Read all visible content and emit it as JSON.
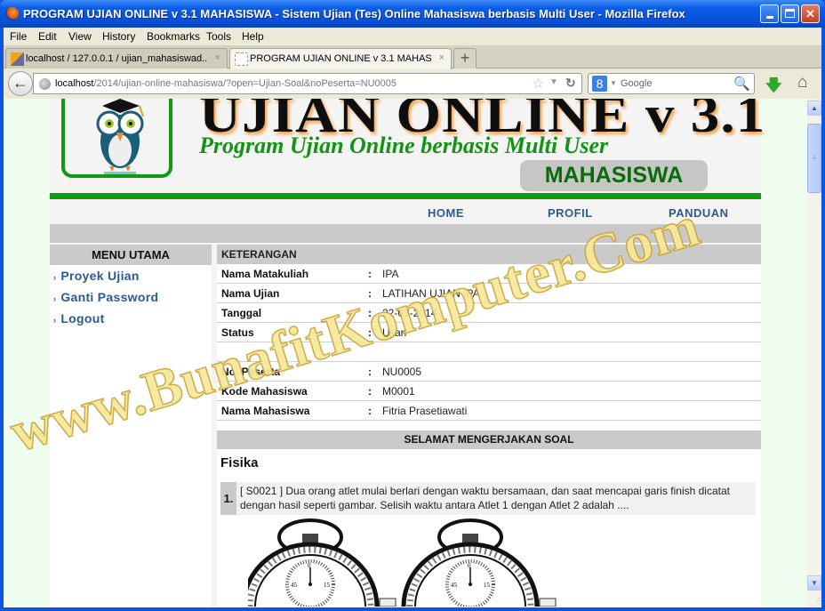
{
  "window": {
    "title": "PROGRAM UJIAN ONLINE v 3.1 MAHASISWA - Sistem Ujian (Tes) Online Mahasiswa berbasis Multi User - Mozilla Firefox",
    "minimize_label": "Minimize",
    "maximize_label": "Maximize",
    "close_label": "✕"
  },
  "menubar": {
    "items": [
      {
        "key": "F",
        "rest": "ile"
      },
      {
        "key": "E",
        "rest": "dit"
      },
      {
        "key": "V",
        "rest": "iew"
      },
      {
        "key": "s",
        "label": "History"
      },
      {
        "key": "B",
        "rest": "ookmarks"
      },
      {
        "key": "T",
        "rest": "ools"
      },
      {
        "key": "H",
        "rest": "elp"
      }
    ],
    "labels": [
      "File",
      "Edit",
      "View",
      "History",
      "Bookmarks",
      "Tools",
      "Help"
    ]
  },
  "tabs": [
    {
      "label": "localhost / 127.0.0.1 / ujian_mahasiswad...",
      "close": "×",
      "icon": "phpmyadmin-icon"
    },
    {
      "label": "PROGRAM UJIAN ONLINE v 3.1 MAHASI...",
      "close": "×",
      "icon": "blank-page-icon",
      "active": true
    }
  ],
  "newtab_label": "+",
  "navbar": {
    "url_host": "localhost",
    "url_path": "/2014/ujian-online-mahasiswa/?open=Ujian-Soal&noPeserta=NU0005",
    "search_placeholder": "Google",
    "search_engine": "8"
  },
  "header": {
    "title": "UJIAN ONLINE v 3.1",
    "subtitle": "Program Ujian Online berbasis Multi User",
    "badge": "MAHASISWA"
  },
  "nav": {
    "links": [
      "HOME",
      "PROFIL",
      "PANDUAN"
    ]
  },
  "sidebar": {
    "heading": "MENU UTAMA",
    "items": [
      {
        "label": "Proyek Ujian"
      },
      {
        "label": "Ganti Password"
      },
      {
        "label": "Logout"
      }
    ]
  },
  "keterangan": {
    "heading": "KETERANGAN",
    "rows": [
      {
        "label": "Nama Matakuliah",
        "value": "IPA"
      },
      {
        "label": "Nama Ujian",
        "value": "LATIHAN UJIAN IPA"
      },
      {
        "label": "Tanggal",
        "value": "22-03-2014"
      },
      {
        "label": "Status",
        "value": "Ujian"
      }
    ],
    "peserta_rows": [
      {
        "label": "No. Peserta",
        "value": "NU0005"
      },
      {
        "label": "Kode Mahasiswa",
        "value": "M0001"
      },
      {
        "label": "Nama Mahasiswa",
        "value": "Fitria Prasetiawati"
      }
    ],
    "colon": ":"
  },
  "exam": {
    "banner": "SELAMAT MENGERJAKAN SOAL",
    "subject": "Fisika",
    "questions": [
      {
        "number": "1.",
        "text": "[ S0021 ] Dua orang atlet mulai berlari dengan waktu bersamaan, dan saat mencapai garis finish dicatat dengan hasil seperti gambar. Selisih waktu antara Atlet 1 dengan Atlet 2 adalah ...."
      }
    ],
    "stopwatch_labels": {
      "top": "0",
      "left": "45",
      "right": "15"
    }
  },
  "watermark": "www.BunafitKomputer.Com"
}
